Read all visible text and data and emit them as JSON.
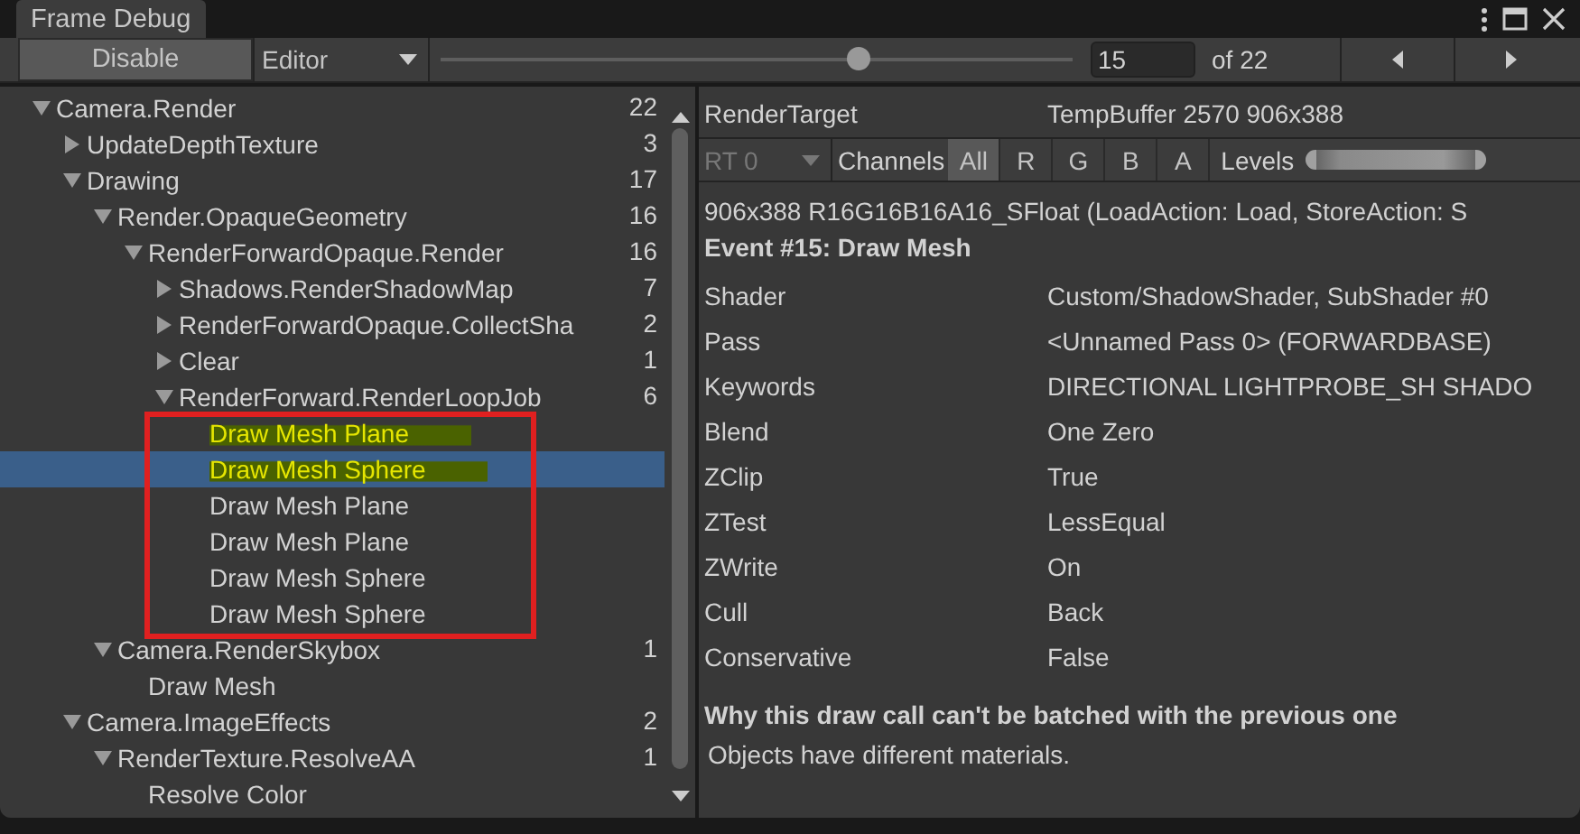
{
  "window": {
    "title": "Frame Debug"
  },
  "toolbar": {
    "disable_button": "Disable",
    "target_dropdown": "Editor",
    "event_slider": {
      "level": 0.66
    },
    "event_field": "15",
    "event_total": "of 22"
  },
  "tree": [
    {
      "name": "Camera.Render",
      "count": "22",
      "expanded": true,
      "children": [
        {
          "name": "UpdateDepthTexture",
          "count": "3",
          "expanded": false
        },
        {
          "name": "Drawing",
          "count": "17",
          "expanded": true,
          "children": [
            {
              "name": "Render.OpaqueGeometry",
              "count": "16",
              "expanded": true,
              "children": [
                {
                  "name": "RenderForwardOpaque.Render",
                  "count": "16",
                  "expanded": true,
                  "children": [
                    {
                      "name": "Shadows.RenderShadowMap",
                      "count": "7",
                      "expanded": false
                    },
                    {
                      "name": "RenderForwardOpaque.CollectSha",
                      "count": "2",
                      "expanded": false
                    },
                    {
                      "name": "Clear",
                      "count": "1",
                      "expanded": false
                    },
                    {
                      "name": "RenderForward.RenderLoopJob",
                      "count": "6",
                      "expanded": true,
                      "outlined": true,
                      "children": [
                        {
                          "name": "Draw Mesh Plane",
                          "selected": false,
                          "marked": true
                        },
                        {
                          "name": "Draw Mesh Sphere",
                          "selected": true,
                          "marked": true
                        },
                        {
                          "name": "Draw Mesh Plane",
                          "selected": false,
                          "marked": false
                        },
                        {
                          "name": "Draw Mesh Plane",
                          "selected": false,
                          "marked": false
                        },
                        {
                          "name": "Draw Mesh Sphere",
                          "selected": false,
                          "marked": false
                        },
                        {
                          "name": "Draw Mesh Sphere",
                          "selected": false,
                          "marked": false
                        }
                      ]
                    }
                  ]
                }
              ]
            },
            {
              "name": "Camera.RenderSkybox",
              "count": "1",
              "expanded": true,
              "children": [
                {
                  "name": "Draw Mesh",
                  "selected": false,
                  "marked": false
                }
              ]
            }
          ]
        },
        {
          "name": "Camera.ImageEffects",
          "count": "2",
          "expanded": true,
          "children": [
            {
              "name": "RenderTexture.ResolveAA",
              "count": "1",
              "expanded": true,
              "children": [
                {
                  "name": "Resolve Color",
                  "selected": false,
                  "marked": false
                }
              ]
            }
          ]
        }
      ]
    }
  ],
  "details": {
    "render_target_label": "RenderTarget",
    "render_target": "TempBuffer 2570 906x388",
    "rt_dropdown": {
      "value": "RT 0",
      "disabled": true
    },
    "channels_label": "Channels",
    "channels": [
      {
        "label": "All",
        "selected": true
      },
      {
        "label": "R",
        "selected": false
      },
      {
        "label": "G",
        "selected": false
      },
      {
        "label": "B",
        "selected": false
      },
      {
        "label": "A",
        "selected": false
      }
    ],
    "levels_label": "Levels",
    "levels_range": {
      "level": 1
    },
    "format": "906x388 R16G16B16A16_SFloat (LoadAction: Load, StoreAction: S",
    "event": "Event #15: Draw Mesh",
    "properties": [
      {
        "name": "Shader",
        "value": "Custom/ShadowShader, SubShader #0"
      },
      {
        "name": "Pass",
        "value": "<Unnamed Pass 0> (FORWARDBASE)"
      },
      {
        "name": "Keywords",
        "value": "DIRECTIONAL LIGHTPROBE_SH SHADO"
      },
      {
        "name": "Blend",
        "value": "One Zero"
      },
      {
        "name": "ZClip",
        "value": "True"
      },
      {
        "name": "ZTest",
        "value": "LessEqual"
      },
      {
        "name": "ZWrite",
        "value": "On"
      },
      {
        "name": "Cull",
        "value": "Back"
      },
      {
        "name": "Conservative",
        "value": "False"
      }
    ],
    "batch_heading": "Why this draw call can't be batched with the previous one",
    "batch_reason": "Objects have different materials."
  }
}
